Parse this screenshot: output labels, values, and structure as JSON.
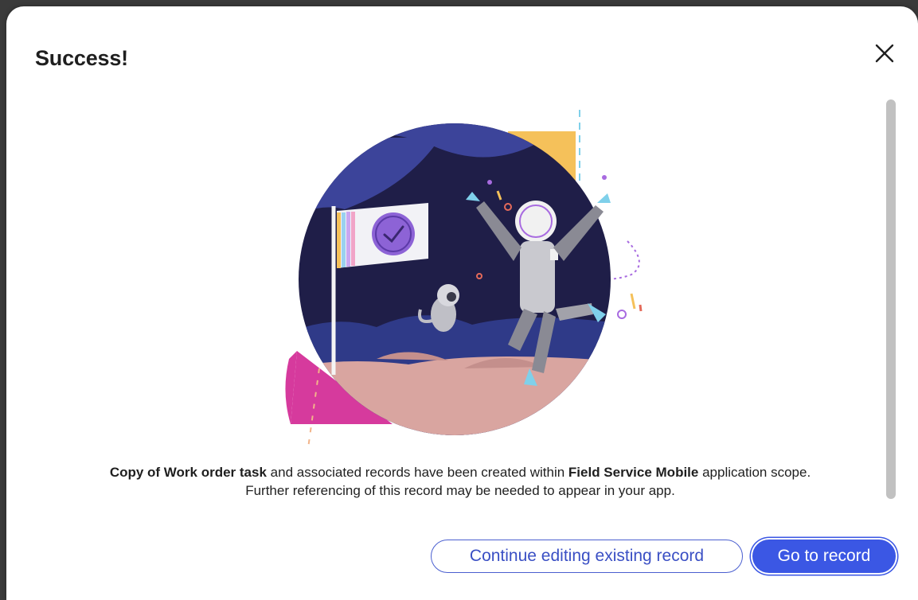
{
  "dialog": {
    "title": "Success!",
    "close_icon": "close-icon",
    "illustration": "astronaut-flag-illustration"
  },
  "message": {
    "part1_bold": "Copy of Work order task",
    "part2": " and associated records have been created within ",
    "part3_bold": "Field Service Mobile",
    "part4": " application scope.",
    "line2": "Further referencing of this record may be needed to appear in your app."
  },
  "actions": {
    "continue_label": "Continue editing existing record",
    "goto_label": "Go to record"
  },
  "colors": {
    "primary": "#3b57e4",
    "primary_text": "#ffffff",
    "secondary_border": "#4a5fd0"
  }
}
